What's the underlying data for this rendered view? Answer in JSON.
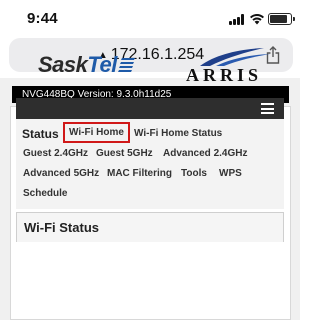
{
  "status_bar": {
    "time": "9:44",
    "icons": [
      "cellular-signal-icon",
      "wifi-icon",
      "battery-icon"
    ]
  },
  "browser": {
    "url": "172.16.1.254",
    "lock_icon": "lock-icon",
    "share_icon": "share-icon"
  },
  "router": {
    "version_text": "NVG448BQ Version: 9.3.0h11d25",
    "logos": {
      "provider": "SaskTel",
      "provider_part1": "Sask",
      "provider_part2": "Tel",
      "manufacturer": "ARRIS"
    },
    "menu_icon": "hamburger-menu-icon",
    "nav": {
      "status": "Status",
      "items": [
        "Wi-Fi Home",
        "Wi-Fi Home Status",
        "Guest 2.4GHz",
        "Guest 5GHz",
        "Advanced 2.4GHz",
        "Advanced 5GHz",
        "MAC Filtering",
        "Tools",
        "WPS",
        "Schedule"
      ],
      "active": "Wi-Fi Home"
    },
    "section_title": "Wi-Fi Status"
  },
  "colors": {
    "highlight_border": "#d01818",
    "sasktel_blue": "#1e5aa8",
    "menu_bar": "#2e2e2e",
    "version_bar": "#000000"
  }
}
